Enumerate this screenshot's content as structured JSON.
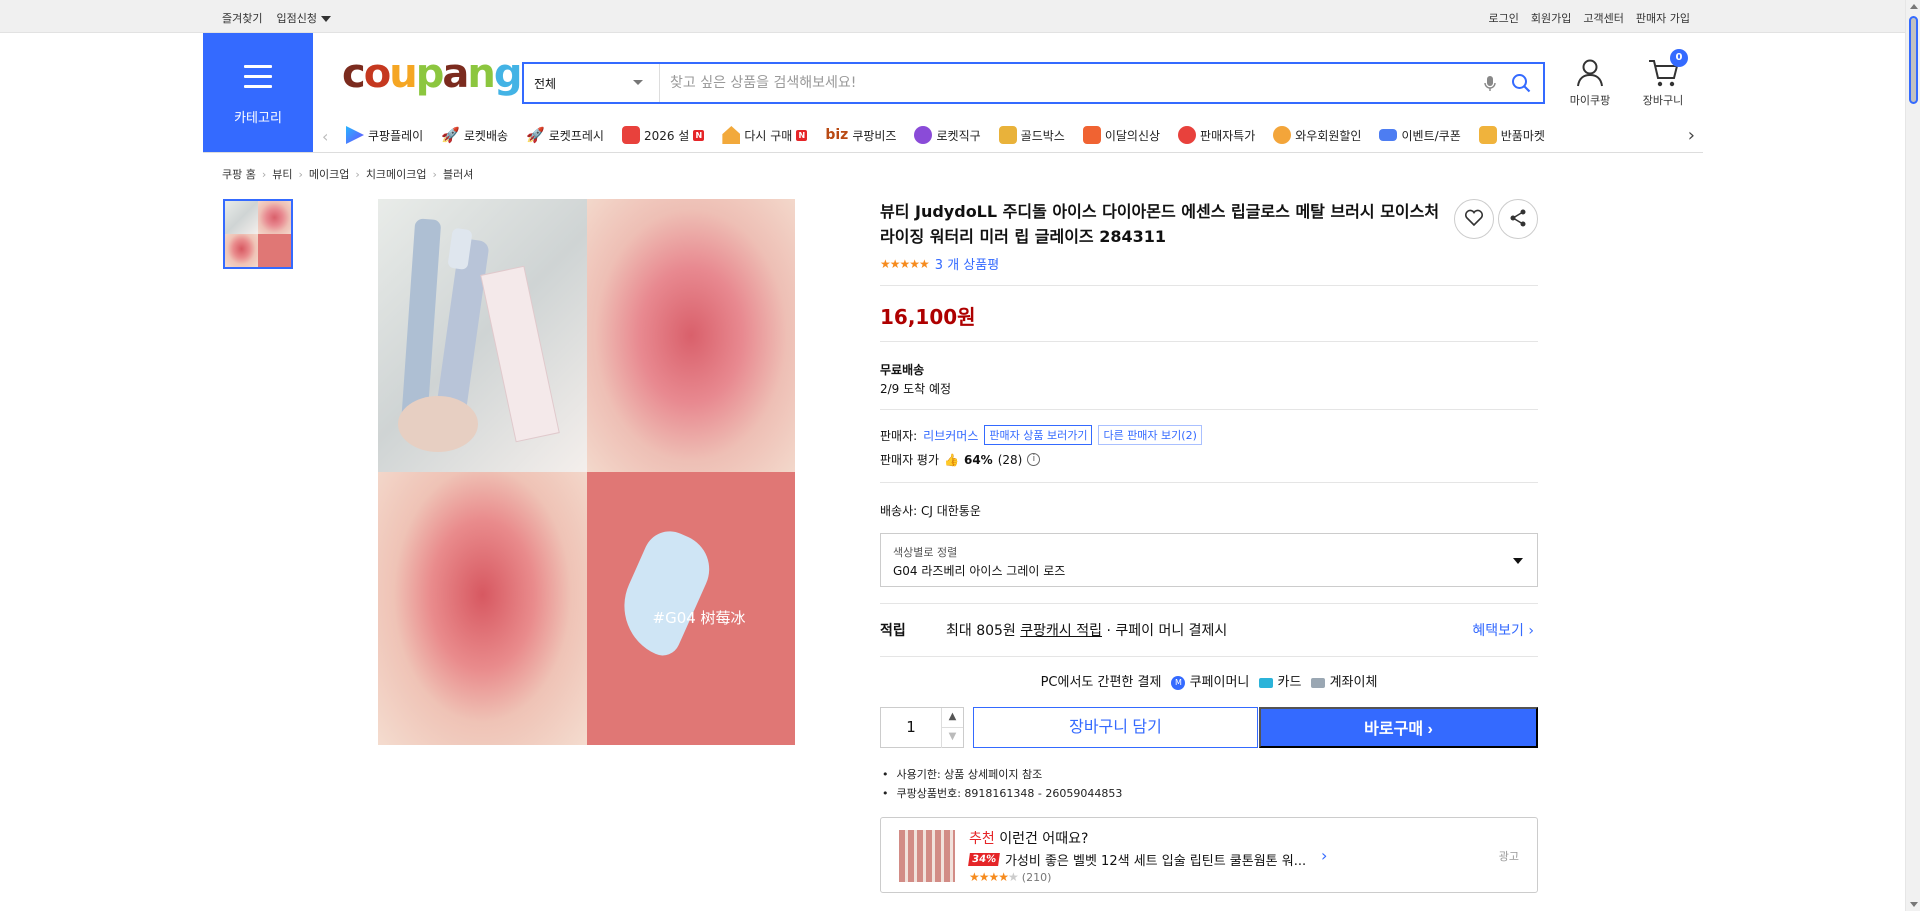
{
  "topbar": {
    "left": [
      "즐겨찾기",
      "입점신청"
    ],
    "right": [
      "로그인",
      "회원가입",
      "고객센터",
      "판매자 가입"
    ]
  },
  "header": {
    "category_label": "카테고리",
    "search": {
      "category": "전체",
      "placeholder": "찾고 싶은 상품을 검색해보세요!"
    },
    "mycoupang_label": "마이쿠팡",
    "cart_label": "장바구니",
    "cart_count": "0"
  },
  "nav": {
    "items": [
      "쿠팡플레이",
      "로켓배송",
      "로켓프레시",
      "2026 설",
      "다시 구매",
      "쿠팡비즈",
      "로켓직구",
      "골드박스",
      "이달의신상",
      "판매자특가",
      "와우회원할인",
      "이벤트/쿠폰",
      "반품마켓"
    ],
    "biz_prefix": "biz"
  },
  "breadcrumb": [
    "쿠팡 홈",
    "뷰티",
    "메이크업",
    "치크메이크업",
    "블러셔"
  ],
  "image": {
    "label": "#G04 树莓冰"
  },
  "product": {
    "title": "뷰티 JudydoLL 주디돌 아이스 다이아몬드 에센스 립글로스 메탈 브러시 모이스처라이징 워터리 미러 립 글레이즈 284311",
    "review_count": "3 개 상품평",
    "rating": 4.5,
    "price": "16,100원",
    "shipping_title": "무료배송",
    "arrival": "2/9 도착 예정",
    "seller_label": "판매자:",
    "seller_name": "리브커머스",
    "seller_products_btn": "판매자 상품 보러가기",
    "other_sellers_btn": "다른 판매자 보기(2)",
    "seller_rating_label": "판매자 평가",
    "seller_rating_pct": "64%",
    "seller_rating_count": "(28)",
    "courier": "배송사:  CJ 대한통운",
    "option_label": "색상별로 정렬",
    "option_value": "G04 라즈베리 아이스 그레이 로즈",
    "benefit_key": "적립",
    "benefit_prefix": "최대 805원",
    "benefit_link": "쿠팡캐시 적립",
    "benefit_suffix": "· 쿠페이 머니 결제시",
    "benefit_more": "혜택보기",
    "pay_title": "PC에서도 간편한 결제",
    "pay_methods": [
      "쿠페이머니",
      "카드",
      "계좌이체"
    ],
    "quantity": "1",
    "add_to_cart": "장바구니 담기",
    "buy_now": "바로구매",
    "notes": [
      "사용기한: 상품 상세페이지 참조",
      "쿠팡상품번호: 8918161348 - 26059044853"
    ]
  },
  "recommend": {
    "tag": "추천",
    "title": "이런건 어때요?",
    "discount": "34%",
    "name": "가성비 좋은 벨벳 12색 세트 입술 립틴트 쿨톤웜톤 워...",
    "review_count": "(210)",
    "rating": 4,
    "ad_label": "광고"
  }
}
